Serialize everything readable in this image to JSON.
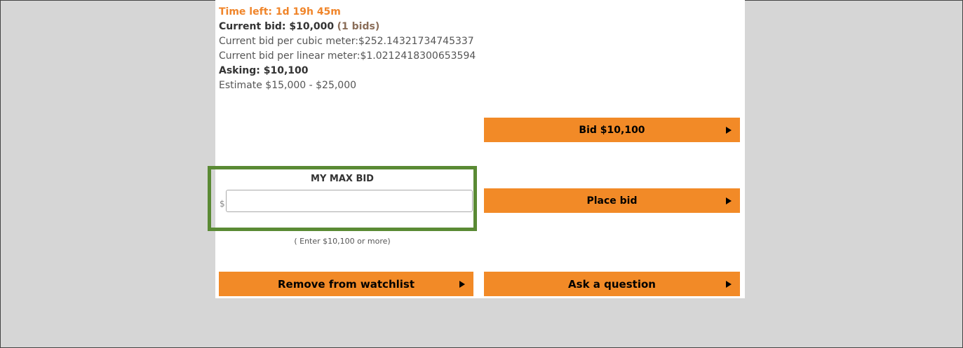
{
  "auction": {
    "time_left": "Time left: 1d 19h 45m",
    "current_bid_label": "Current bid: $10,000",
    "bid_count": "(1 bids)",
    "per_cubic_meter": "Current bid per cubic meter:$252.14321734745337",
    "per_linear_meter": "Current bid per linear meter:$1.0212418300653594",
    "asking": "Asking: $10,100",
    "estimate": "Estimate $15,000 - $25,000"
  },
  "buttons": {
    "bid": "Bid $10,100",
    "place_bid": "Place bid",
    "remove_watchlist": "Remove from watchlist",
    "ask_question": "Ask a question"
  },
  "max_bid": {
    "title": "MY MAX BID",
    "currency": "$",
    "value": "",
    "hint": "( Enter $10,100 or more)"
  },
  "colors": {
    "accent": "#f28a27",
    "highlight_box": "#5a8a34",
    "time_left": "#f0852a"
  },
  "icons": {
    "button_arrow": "play-arrow-icon"
  }
}
